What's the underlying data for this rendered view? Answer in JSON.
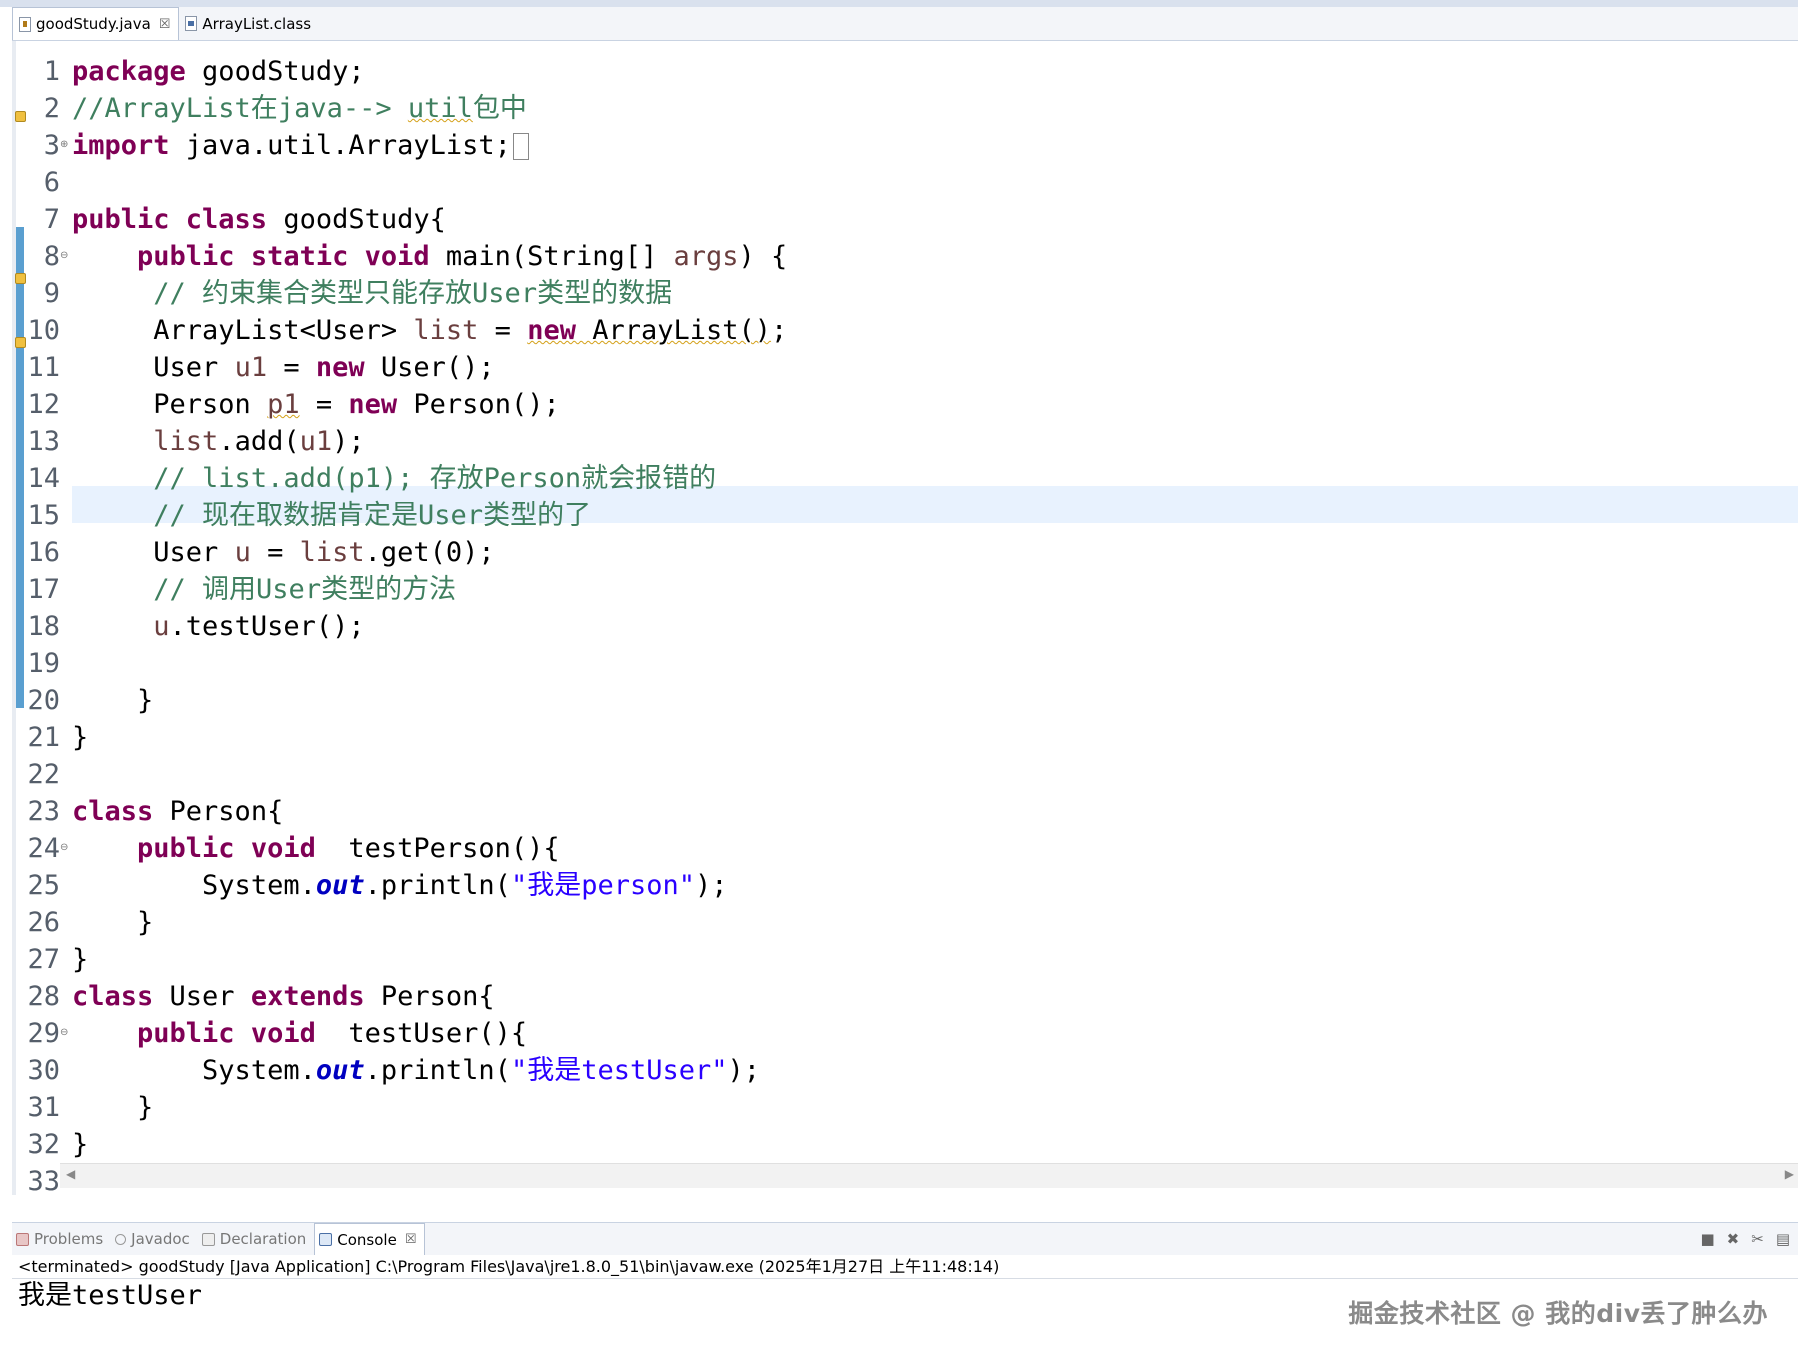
{
  "editor_tabs": [
    {
      "label": "goodStudy.java",
      "close": "☒",
      "active": true
    },
    {
      "label": "ArrayList.class",
      "active": false
    }
  ],
  "code_lines": [
    "1",
    "2",
    "3",
    "6",
    "7",
    "8",
    "9",
    "10",
    "11",
    "12",
    "13",
    "14",
    "15",
    "16",
    "17",
    "18",
    "19",
    "20",
    "21",
    "22",
    "23",
    "24",
    "25",
    "26",
    "27",
    "28",
    "29",
    "30",
    "31",
    "32",
    "33"
  ],
  "code": {
    "l1": {
      "kw": "package",
      "rest": " goodStudy;"
    },
    "l2": {
      "comment": "//ArrayList在java--> ",
      "warn": "util",
      "comment2": "包中"
    },
    "l3": {
      "kw": "import",
      "rest": " java.util.ArrayList;"
    },
    "l7": {
      "kw": "public class",
      "rest": " goodStudy{"
    },
    "l8": {
      "kw": "public static void",
      "rest": " main(String[] ",
      "var": "args",
      "rest2": ") {"
    },
    "l9": {
      "comment": "// 约束集合类型只能存放User类型的数据"
    },
    "l10": {
      "a": "ArrayList<User> ",
      "var": "list",
      "b": " = ",
      "kw": "new",
      "warn": " ArrayList()",
      "c": ";"
    },
    "l11": {
      "a": "User ",
      "var": "u1",
      "b": " = ",
      "kw": "new",
      "c": " User();"
    },
    "l12": {
      "a": "Person ",
      "var": "p1",
      "b": " = ",
      "kw": "new",
      "c": " Person();"
    },
    "l13": {
      "var": "list",
      "a": ".add(",
      "var2": "u1",
      "b": ");"
    },
    "l14": {
      "comment": "// list.add(p1); 存放Person就会报错的"
    },
    "l15": {
      "comment": "// 现在取数据肯定是User类型的了"
    },
    "l16": {
      "a": "User ",
      "var": "u",
      "b": " = ",
      "var2": "list",
      "c": ".get(0);"
    },
    "l17": {
      "comment": "// 调用User类型的方法"
    },
    "l18": {
      "var": "u",
      "a": ".testUser();"
    },
    "l20": {
      "a": "}"
    },
    "l21": {
      "a": "}"
    },
    "l23": {
      "kw": "class",
      "rest": " Person{"
    },
    "l24": {
      "kw": "public void",
      "rest": "  testPerson(){"
    },
    "l25": {
      "a": "System.",
      "field": "out",
      "b": ".println(",
      "str": "\"我是person\"",
      "c": ");"
    },
    "l26": {
      "a": "}"
    },
    "l27": {
      "a": "}"
    },
    "l28": {
      "kw": "class",
      "a": " User ",
      "kw2": "extends",
      "b": " Person{"
    },
    "l29": {
      "kw": "public void",
      "rest": "  testUser(){"
    },
    "l30": {
      "a": "System.",
      "field": "out",
      "b": ".println(",
      "str": "\"我是testUser\"",
      "c": ");"
    },
    "l31": {
      "a": "}"
    },
    "l32": {
      "a": "}"
    }
  },
  "views": {
    "tabs": [
      {
        "label": "Problems"
      },
      {
        "label": "Javadoc"
      },
      {
        "label": "Declaration"
      },
      {
        "label": "Console",
        "close": "☒",
        "active": true
      }
    ]
  },
  "console": {
    "header": "<terminated> goodStudy [Java Application] C:\\Program Files\\Java\\jre1.8.0_51\\bin\\javaw.exe (2025年1月27日 上午11:48:14)",
    "output": "我是testUser"
  },
  "watermark": "掘金技术社区 @ 我的div丢了肿么办",
  "colors": {
    "keyword": "#7f0055",
    "comment": "#3f7f5f",
    "string": "#2a00ff",
    "field": "#0000c0",
    "local_var": "#6a3e3e",
    "change_bar": "#5a9fd0",
    "current_line": "#e8f2fe"
  },
  "icons": [
    "java-file-icon",
    "class-file-icon",
    "problems-icon",
    "javadoc-icon",
    "declaration-icon",
    "console-icon",
    "warning-icon",
    "fold-icon",
    "terminate-icon",
    "remove-launch-icon",
    "clear-console-icon"
  ]
}
